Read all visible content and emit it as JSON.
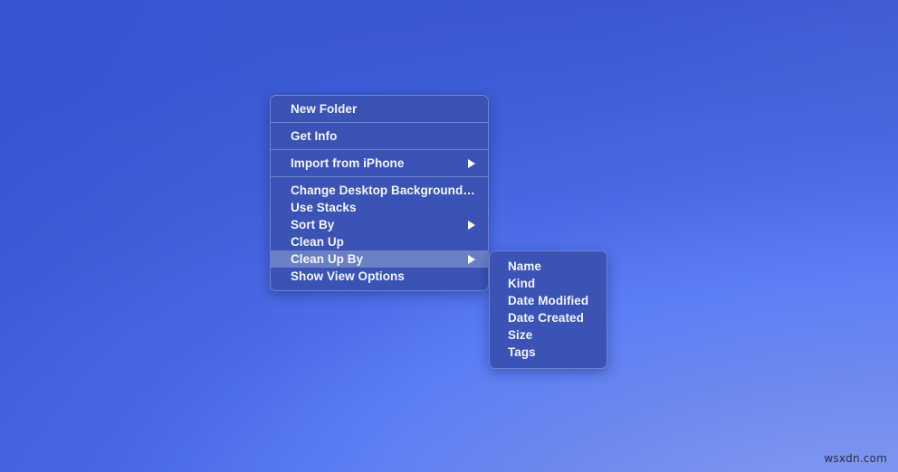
{
  "desktop": {
    "background_gradient_from": "#3a57d0",
    "background_gradient_to": "#8ea0f5"
  },
  "watermark": {
    "text": "wsxdn.com"
  },
  "context_menu": {
    "name": "desktop-context-menu",
    "background_color": "#3a53b5",
    "text_color": "#f2f4fd",
    "highlight_color": "#6b7fc4",
    "border_color": "#6f82cf",
    "groups": [
      {
        "items": [
          {
            "label": "New Folder",
            "has_submenu": false,
            "highlighted": false
          }
        ]
      },
      {
        "items": [
          {
            "label": "Get Info",
            "has_submenu": false,
            "highlighted": false
          }
        ]
      },
      {
        "items": [
          {
            "label": "Import from iPhone",
            "has_submenu": true,
            "highlighted": false
          }
        ]
      },
      {
        "items": [
          {
            "label": "Change Desktop Background…",
            "has_submenu": false,
            "highlighted": false
          },
          {
            "label": "Use Stacks",
            "has_submenu": false,
            "highlighted": false
          },
          {
            "label": "Sort By",
            "has_submenu": true,
            "highlighted": false
          },
          {
            "label": "Clean Up",
            "has_submenu": false,
            "highlighted": false
          },
          {
            "label": "Clean Up By",
            "has_submenu": true,
            "highlighted": true
          },
          {
            "label": "Show View Options",
            "has_submenu": false,
            "highlighted": false
          }
        ]
      }
    ]
  },
  "submenu": {
    "name": "clean-up-by-submenu",
    "parent_label": "Clean Up By",
    "items": [
      {
        "label": "Name"
      },
      {
        "label": "Kind"
      },
      {
        "label": "Date Modified"
      },
      {
        "label": "Date Created"
      },
      {
        "label": "Size"
      },
      {
        "label": "Tags"
      }
    ]
  }
}
